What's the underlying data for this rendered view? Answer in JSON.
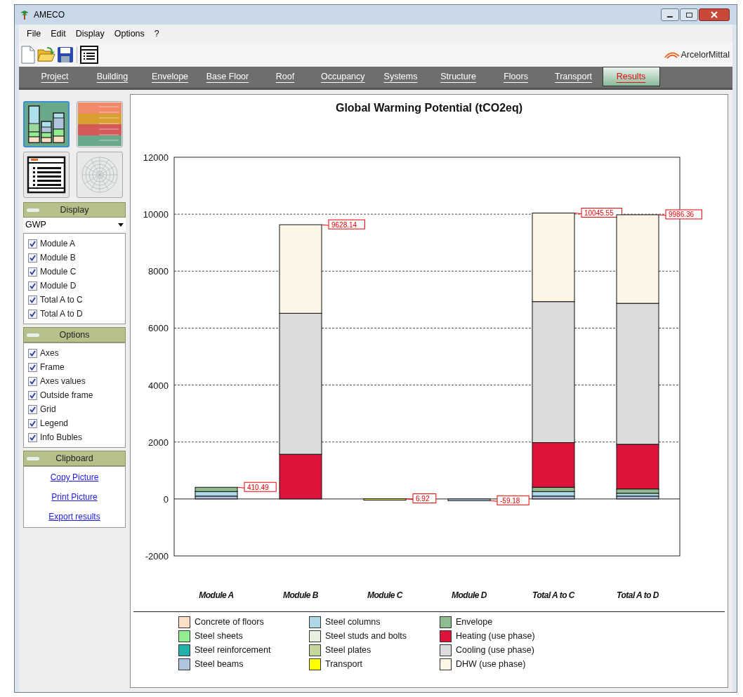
{
  "window": {
    "title": "AMECO"
  },
  "menu": [
    "File",
    "Edit",
    "Display",
    "Options",
    "?"
  ],
  "brand": "ArcelorMittal",
  "tabs": [
    {
      "label": "Project",
      "selected": false
    },
    {
      "label": "Building",
      "selected": false
    },
    {
      "label": "Envelope",
      "selected": false
    },
    {
      "label": "Base Floor",
      "selected": false
    },
    {
      "label": "Roof",
      "selected": false
    },
    {
      "label": "Occupancy",
      "selected": false
    },
    {
      "label": "Systems",
      "selected": false
    },
    {
      "label": "Structure",
      "selected": false
    },
    {
      "label": "Floors",
      "selected": false
    },
    {
      "label": "Transport",
      "selected": false
    },
    {
      "label": "Results",
      "selected": true
    }
  ],
  "views": [
    {
      "kind": "bars",
      "selected": true
    },
    {
      "kind": "table",
      "selected": false
    },
    {
      "kind": "report",
      "selected": false
    },
    {
      "kind": "radar",
      "selected": false
    }
  ],
  "display": {
    "title": "Display",
    "dropdown": "GWP",
    "items": [
      {
        "label": "Module A",
        "checked": true
      },
      {
        "label": "Module B",
        "checked": true
      },
      {
        "label": "Module C",
        "checked": true
      },
      {
        "label": "Module D",
        "checked": true
      },
      {
        "label": "Total A to C",
        "checked": true
      },
      {
        "label": "Total A to D",
        "checked": true
      }
    ]
  },
  "options": {
    "title": "Options",
    "items": [
      {
        "label": "Axes",
        "checked": true
      },
      {
        "label": "Frame",
        "checked": true
      },
      {
        "label": "Axes values",
        "checked": true
      },
      {
        "label": "Outside frame",
        "checked": true
      },
      {
        "label": "Grid",
        "checked": true
      },
      {
        "label": "Legend",
        "checked": true
      },
      {
        "label": "Info Bubles",
        "checked": true
      }
    ]
  },
  "clipboard": {
    "title": "Clipboard",
    "links": [
      "Copy Picture",
      "Print Picture",
      "Export results"
    ]
  },
  "chart_data": {
    "type": "bar",
    "title": "Global Warming Potential (tCO2eq)",
    "stacked": true,
    "categories": [
      "Module A",
      "Module B",
      "Module C",
      "Module D",
      "Total A to C",
      "Total A to D"
    ],
    "ylim": [
      -2000,
      12000
    ],
    "grid": true,
    "yticks": [
      -2000,
      0,
      2000,
      4000,
      6000,
      8000,
      10000,
      12000
    ],
    "series": [
      {
        "name": "Concrete of floors",
        "color": "#fde0c5",
        "values": [
          0,
          0,
          0,
          0,
          0,
          0
        ]
      },
      {
        "name": "Steel sheets",
        "color": "#90ee90",
        "values": [
          0,
          0,
          0,
          0,
          0,
          0
        ]
      },
      {
        "name": "Steel reinforcement",
        "color": "#20b2aa",
        "values": [
          0,
          0,
          0,
          0,
          0,
          0
        ]
      },
      {
        "name": "Steel beams",
        "color": "#b0c4de",
        "values": [
          100,
          0,
          0,
          0,
          100,
          100
        ]
      },
      {
        "name": "Steel columns",
        "color": "#add8e6",
        "values": [
          160,
          0,
          0,
          -60,
          160,
          100
        ]
      },
      {
        "name": "Steel studs and bolts",
        "color": "#e8f0e0",
        "values": [
          0,
          0,
          0,
          0,
          0,
          0
        ]
      },
      {
        "name": "Steel plates",
        "color": "#c3d69b",
        "values": [
          0,
          0,
          0,
          0,
          0,
          0
        ]
      },
      {
        "name": "Transport",
        "color": "#ffff00",
        "values": [
          0,
          0,
          7,
          0,
          0,
          0
        ]
      },
      {
        "name": "Envelope",
        "color": "#8fbc8f",
        "values": [
          150,
          0,
          0,
          0,
          150,
          150
        ]
      },
      {
        "name": "Heating (use phase)",
        "color": "#dc143c",
        "values": [
          0,
          1570,
          0,
          0,
          1570,
          1570
        ]
      },
      {
        "name": "Cooling (use phase)",
        "color": "#dcdcdc",
        "values": [
          0,
          4950,
          0,
          0,
          4950,
          4950
        ]
      },
      {
        "name": "DHW (use phase)",
        "color": "#fdf5e6",
        "values": [
          0,
          3110,
          0,
          0,
          3110,
          3110
        ]
      }
    ],
    "value_labels": [
      "410.49",
      "9628.14",
      "6.92",
      "-59.18",
      "10045.55",
      "9986.36"
    ]
  }
}
